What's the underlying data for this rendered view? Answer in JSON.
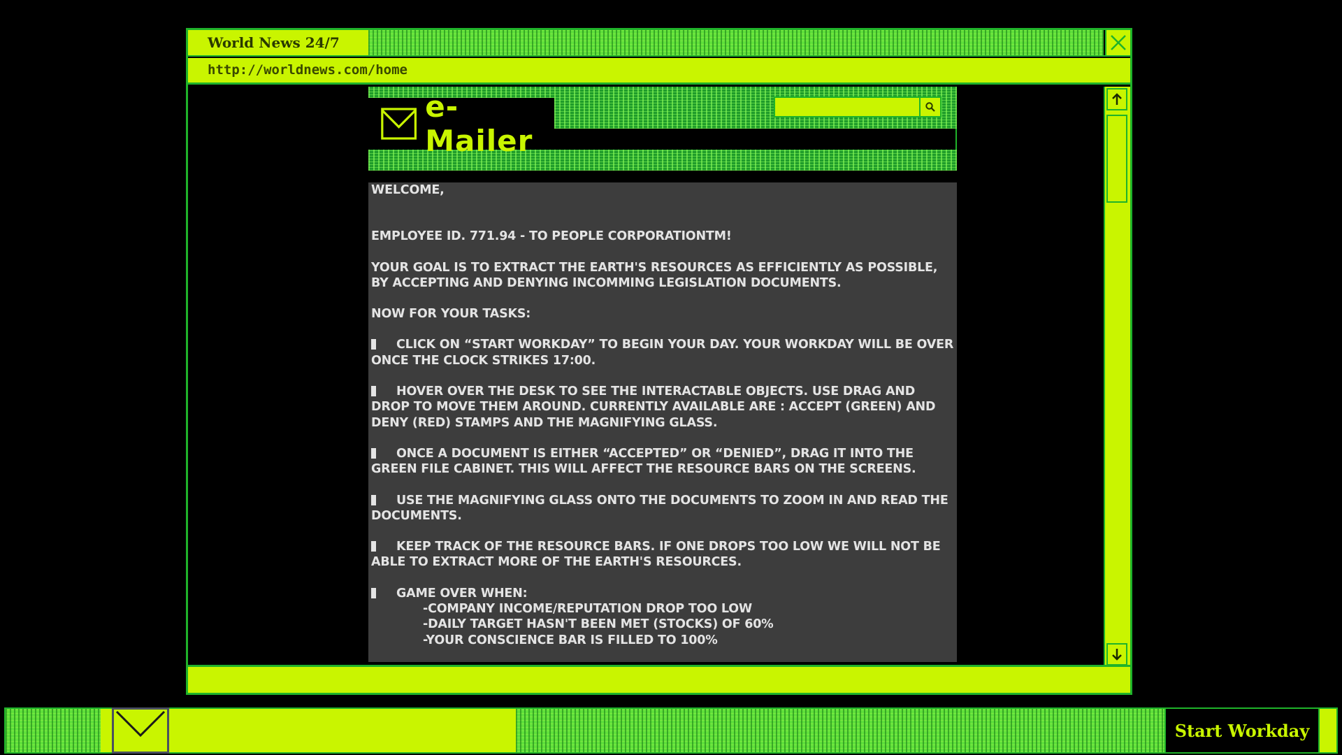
{
  "window": {
    "title": "World News 24/7",
    "url": "http://worldnews.com/home"
  },
  "mail": {
    "logo_text": "e-Mailer",
    "search": {
      "placeholder": ""
    },
    "body": {
      "greeting": "WELCOME,",
      "employee_line": "EMPLOYEE ID. 771.94 - TO PEOPLE CORPORATIONTM!",
      "goal": "YOUR GOAL IS TO EXTRACT THE EARTH'S RESOURCES AS EFFICIENTLY AS POSSIBLE, BY ACCEPTING AND DENYING INCOMMING LEGISLATION DOCUMENTS.",
      "tasks_header": "NOW FOR YOUR TASKS:",
      "tasks": [
        "CLICK ON “START WORKDAY” TO BEGIN YOUR DAY. YOUR WORKDAY WILL BE OVER ONCE THE CLOCK STRIKES 17:00.",
        "HOVER OVER THE DESK TO  SEE THE INTERACTABLE OBJECTS. USE DRAG AND DROP TO MOVE THEM AROUND. CURRENTLY AVAILABLE ARE : ACCEPT (GREEN) AND DENY (RED) STAMPS AND THE MAGNIFYING GLASS.",
        "ONCE A DOCUMENT IS EITHER “ACCEPTED” OR “DENIED”, DRAG IT INTO THE GREEN FILE CABINET. THIS WILL AFFECT THE RESOURCE BARS ON THE SCREENS.",
        "USE THE MAGNIFYING GLASS ONTO THE DOCUMENTS TO ZOOM IN AND READ THE DOCUMENTS.",
        "KEEP TRACK OF THE RESOURCE BARS. IF ONE DROPS TOO LOW WE WILL NOT BE ABLE TO EXTRACT MORE OF THE EARTH'S RESOURCES.",
        "GAME OVER WHEN:"
      ],
      "game_over_conditions": [
        "-COMPANY INCOME/REPUTATION DROP TOO LOW",
        "-DAILY TARGET HASN'T BEEN MET (STOCKS) OF 60%",
        "-YOUR CONSCIENCE BAR IS FILLED TO 100%"
      ]
    }
  },
  "taskbar": {
    "start_label": "Start Workday"
  },
  "icons": {
    "close": "close-icon",
    "search": "search-icon",
    "scroll_up": "arrow-up-icon",
    "scroll_down": "arrow-down-icon",
    "mail": "envelope-icon"
  },
  "colors": {
    "accent": "#c9f500",
    "border": "#1fb32a",
    "stripe": "#5fe03a",
    "panel": "#3d3d3d",
    "background": "#000000"
  }
}
